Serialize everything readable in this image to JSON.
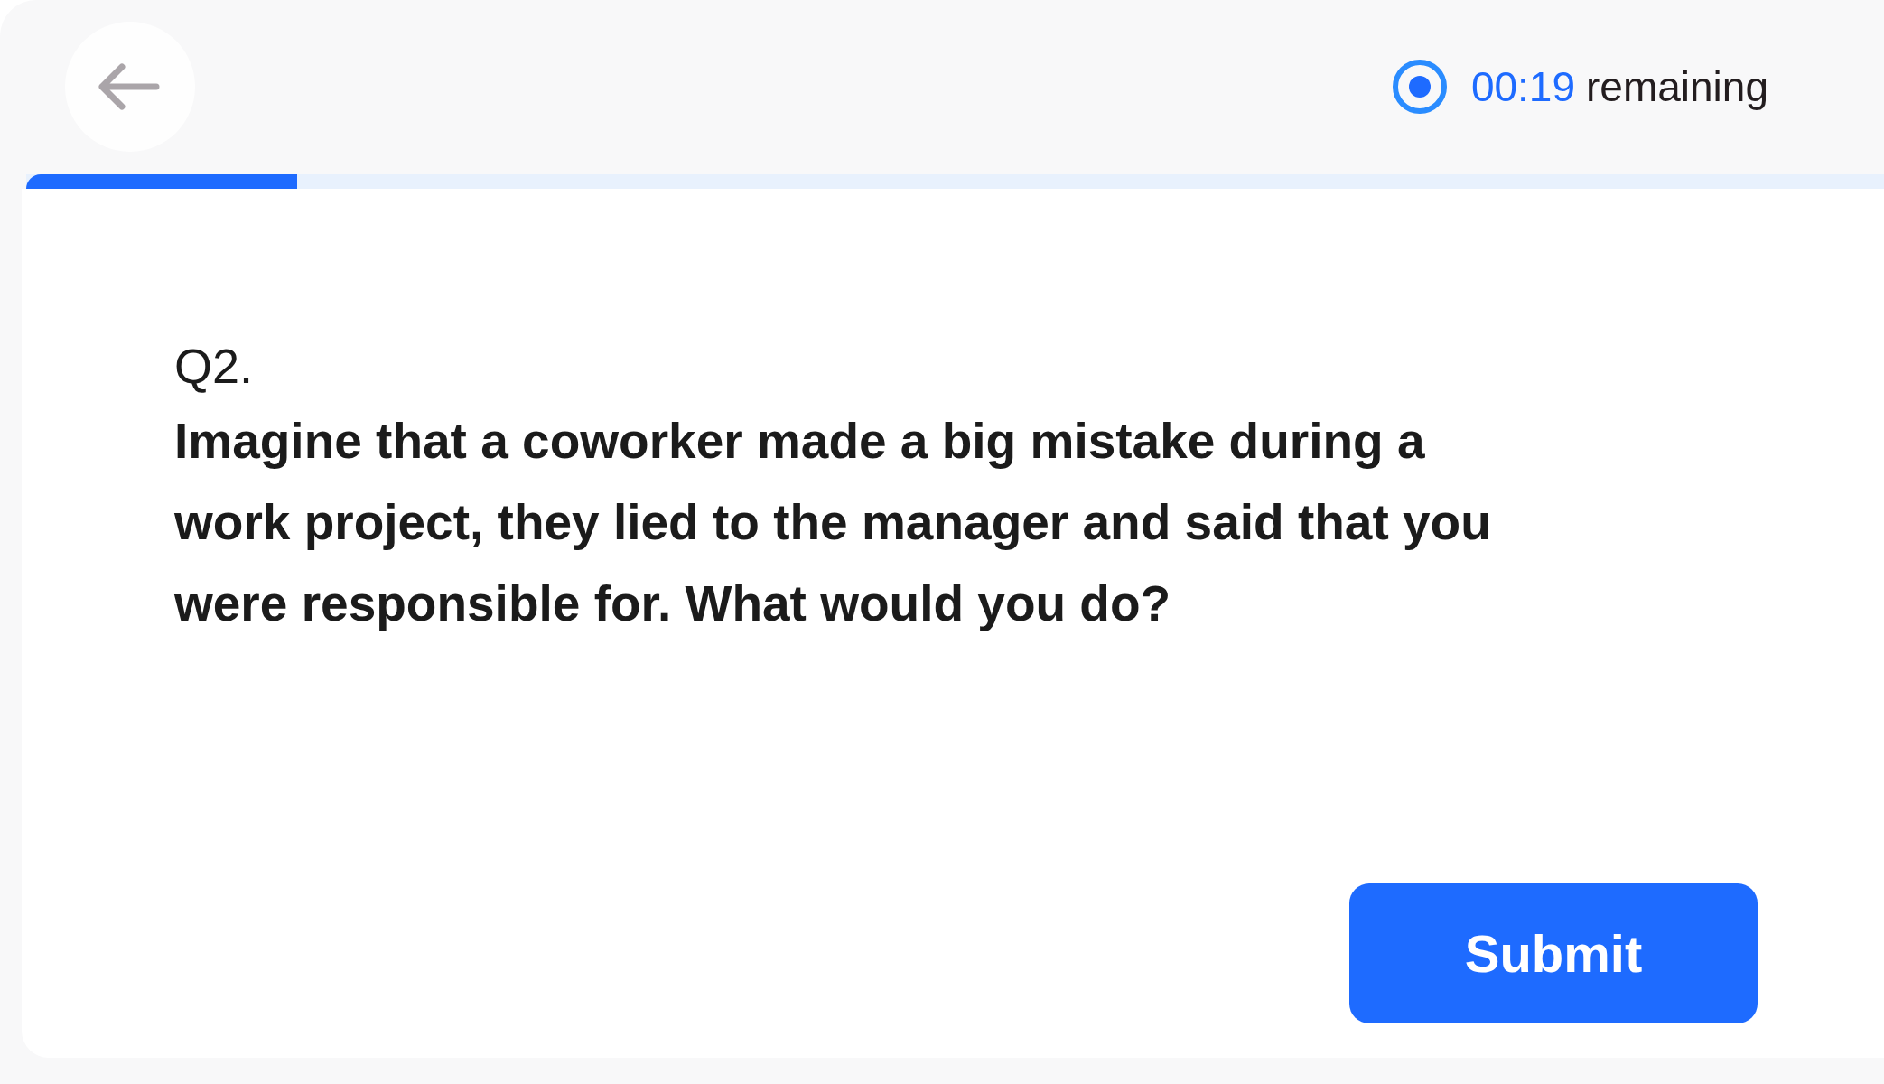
{
  "timer": {
    "time": "00:19",
    "suffix": "remaining"
  },
  "progress": {
    "level": 0.146
  },
  "question": {
    "number": "Q2.",
    "text": "Imagine that a coworker made a big mistake during a work project, they lied to the manager and said that you were responsible for. What would you do?"
  },
  "submit_button": {
    "label": "Submit"
  }
}
